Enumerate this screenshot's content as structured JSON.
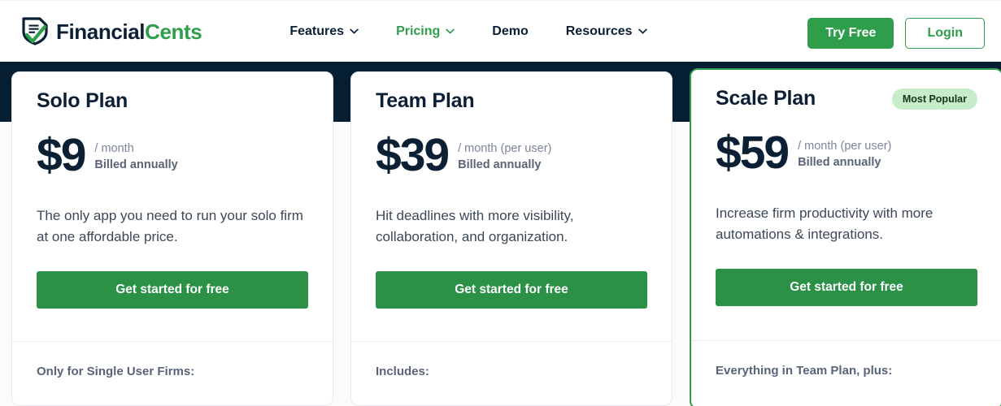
{
  "header": {
    "logo": {
      "icon": "shield-document-check-icon",
      "text_part1": "Financial",
      "text_part2": "Cents"
    },
    "nav": [
      {
        "label": "Features",
        "icon": "chevron-down-icon",
        "has_chevron": true,
        "active": false
      },
      {
        "label": "Pricing",
        "icon": "chevron-down-icon",
        "has_chevron": true,
        "active": true
      },
      {
        "label": "Demo",
        "icon": "",
        "has_chevron": false,
        "active": false
      },
      {
        "label": "Resources",
        "icon": "chevron-down-icon",
        "has_chevron": true,
        "active": false
      }
    ],
    "try_free_label": "Try Free",
    "login_label": "Login"
  },
  "colors": {
    "brand_green": "#2e9e4b",
    "cta_green": "#2b9146",
    "navy": "#061e32",
    "badge_bg": "#c6ecc9",
    "heading": "#0b1f35"
  },
  "plans": [
    {
      "title": "Solo Plan",
      "badge": "",
      "price": "$9",
      "unit": "/ month",
      "billed": "Billed annually",
      "description": "The only app you need to run your solo firm at one affordable price.",
      "cta": "Get started for free",
      "includes_label": "Only for Single User Firms:",
      "featured": false
    },
    {
      "title": "Team Plan",
      "badge": "",
      "price": "$39",
      "unit": "/ month (per user)",
      "billed": "Billed annually",
      "description": "Hit deadlines with more visibility, collaboration, and organization.",
      "cta": "Get started for free",
      "includes_label": "Includes:",
      "featured": false
    },
    {
      "title": "Scale Plan",
      "badge": "Most Popular",
      "price": "$59",
      "unit": "/ month (per user)",
      "billed": "Billed annually",
      "description": "Increase firm productivity with more automations & integrations.",
      "cta": "Get started for free",
      "includes_label": "Everything in Team Plan, plus:",
      "featured": true
    }
  ]
}
